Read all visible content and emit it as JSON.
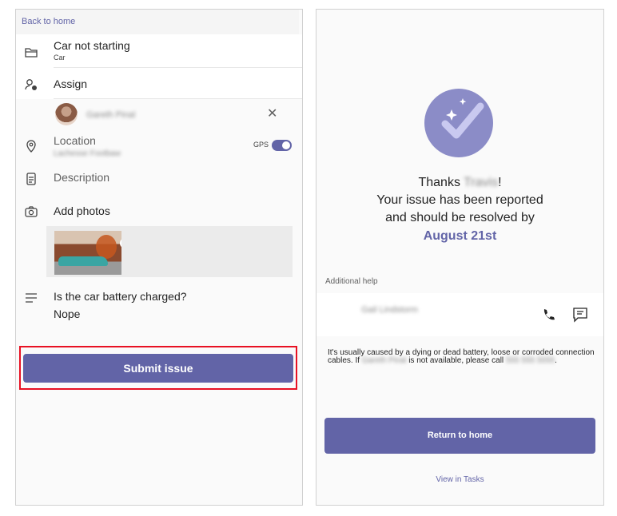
{
  "left": {
    "back_link": "Back to home",
    "issue_title": "Car not starting",
    "issue_category": "Car",
    "assign_label": "Assign",
    "assignee_name": "Gareth Pinal",
    "location_label": "Location",
    "location_value": "Lachesse Footbaw",
    "gps_label": "GPS",
    "gps_enabled": true,
    "description_placeholder": "Description",
    "add_photos_label": "Add photos",
    "question": "Is the car battery charged?",
    "answer": "Nope",
    "submit_label": "Submit issue"
  },
  "right": {
    "thanks_prefix": "Thanks",
    "thanks_name": "Travis",
    "thanks_suffix": "!",
    "line2": "Your issue has been reported",
    "line3": "and should be resolved by",
    "resolve_date": "August 21st",
    "additional_help_label": "Additional help",
    "contact_name": "Gail Lindstorm",
    "help_text_1": "It's usually caused by a dying or dead battery, loose or corroded connection cables. If",
    "help_blur_name": "Gareth Pinal",
    "help_text_2": "is not available, please call",
    "help_blur_phone": "555 555 5555",
    "help_text_3": ".",
    "return_label": "Return to home",
    "view_tasks_label": "View in Tasks"
  },
  "colors": {
    "accent": "#6264a7",
    "highlight": "#e81123"
  },
  "icons": [
    "folder-icon",
    "assign-person-icon",
    "location-pin-icon",
    "notes-icon",
    "camera-icon",
    "list-lines-icon",
    "close-icon",
    "trash-icon",
    "phone-icon",
    "chat-icon",
    "checkmark-badge-icon"
  ]
}
